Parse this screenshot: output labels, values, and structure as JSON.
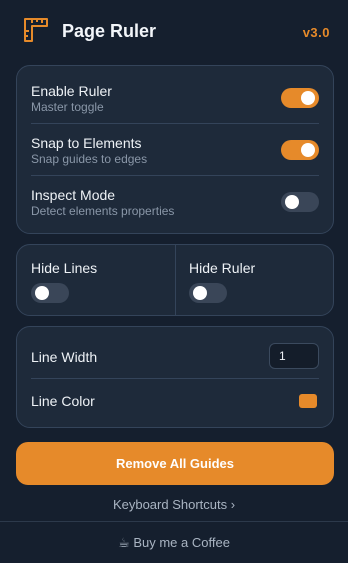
{
  "header": {
    "title": "Page Ruler",
    "version": "v3.0",
    "logo_icon": "ruler-icon"
  },
  "settings": {
    "enable_ruler": {
      "label": "Enable Ruler",
      "sub": "Master toggle",
      "on": true
    },
    "snap": {
      "label": "Snap to Elements",
      "sub": "Snap guides to edges",
      "on": true
    },
    "inspect": {
      "label": "Inspect Mode",
      "sub": "Detect elements properties",
      "on": false
    }
  },
  "visibility": {
    "hide_lines": {
      "label": "Hide Lines",
      "on": false
    },
    "hide_ruler": {
      "label": "Hide Ruler",
      "on": false
    }
  },
  "line": {
    "width_label": "Line Width",
    "width_value": "1",
    "color_label": "Line Color",
    "color_value": "#e68a2a"
  },
  "actions": {
    "remove_all": "Remove All Guides",
    "shortcuts": "Keyboard Shortcuts  ›",
    "coffee": "☕ Buy me a Coffee"
  },
  "colors": {
    "accent": "#e68a2a",
    "background": "#151f2e",
    "card": "#1e2a3a"
  }
}
